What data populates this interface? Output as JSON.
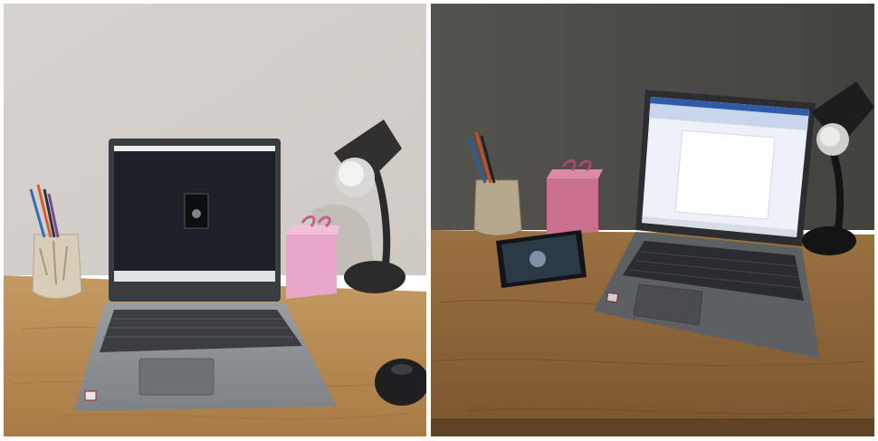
{
  "figure": {
    "panels": [
      {
        "id": "left",
        "scene": "bright",
        "colors": {
          "wall": "#d9d5d0",
          "desk": "#b8874f",
          "laptop": "#8c8f92",
          "screen": "#1d2027",
          "gift_box": "#e8a6c8",
          "lamp": "#2a2a2a"
        }
      },
      {
        "id": "right",
        "scene": "dim",
        "colors": {
          "wall": "#4b4a46",
          "desk": "#8a6436",
          "laptop": "#5d6063",
          "screen": "#eef2f8",
          "gift_box": "#c9708f",
          "lamp": "#141414"
        }
      }
    ],
    "objects": [
      "pen-holder",
      "laptop",
      "desk-lamp",
      "gift-box",
      "mouse",
      "smartphone"
    ]
  }
}
